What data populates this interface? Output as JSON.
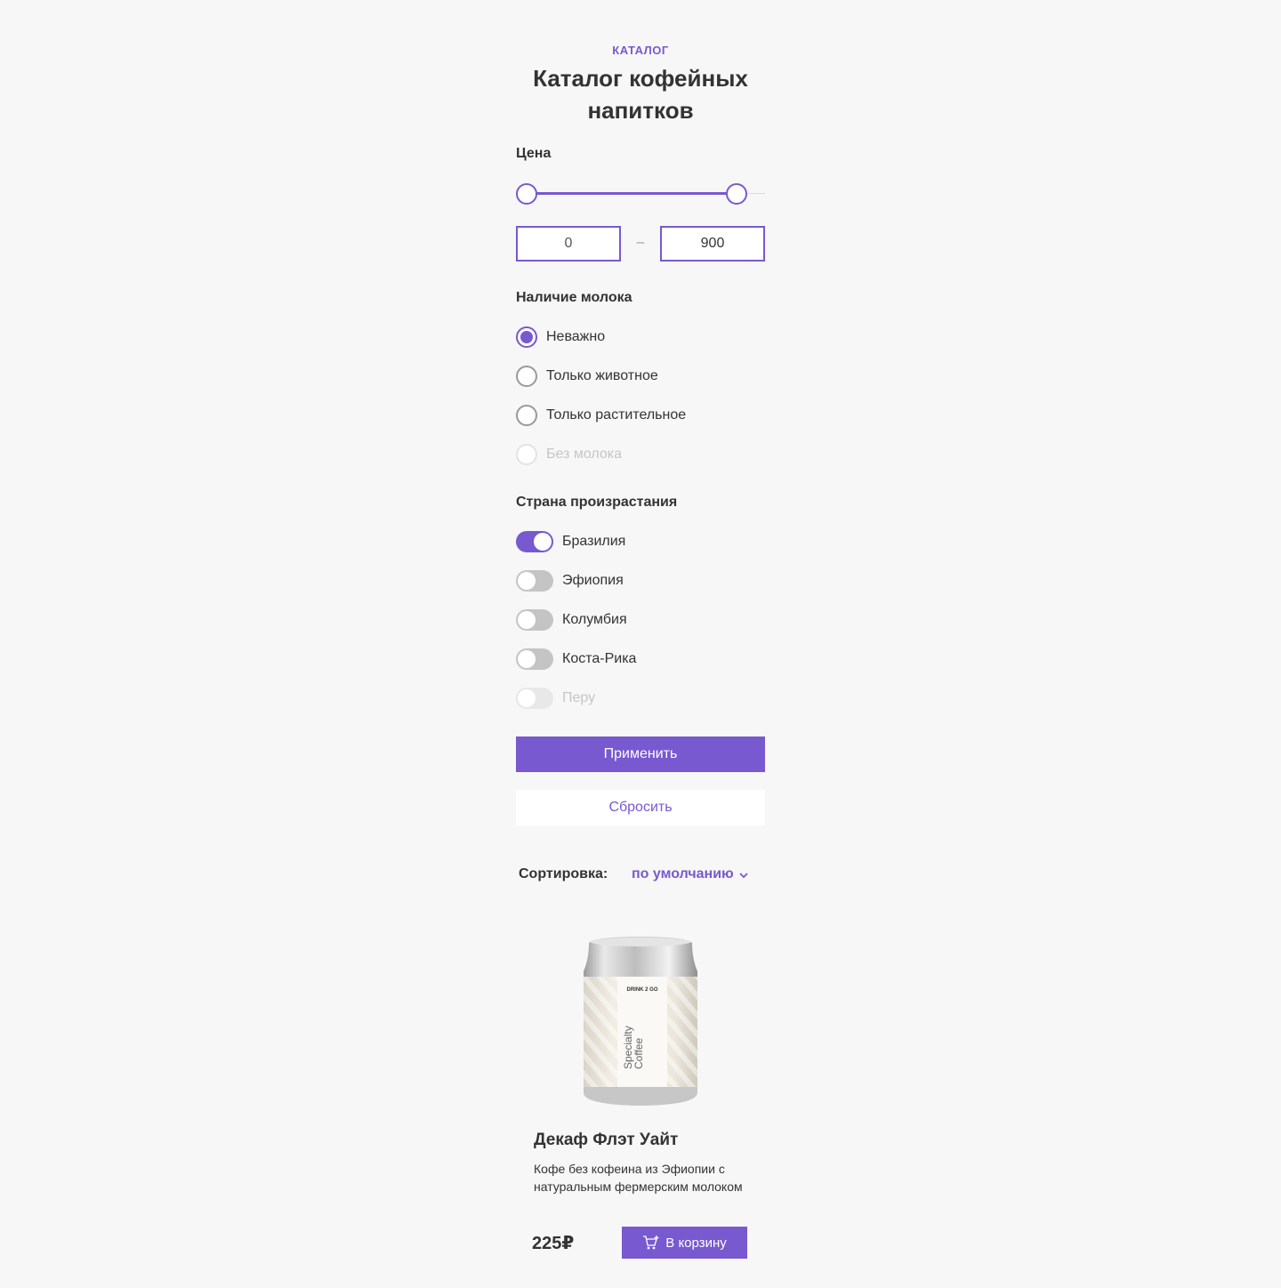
{
  "header": {
    "eyebrow": "КАТАЛОГ",
    "title": "Каталог кофейных напитков"
  },
  "price": {
    "label": "Цена",
    "min_value": "0",
    "max_value": "900",
    "separator": "–",
    "slider_min_fraction": 0,
    "slider_max_fraction": 1
  },
  "milk": {
    "label": "Наличие молока",
    "options": [
      {
        "label": "Неважно",
        "checked": true,
        "disabled": false
      },
      {
        "label": "Только животное",
        "checked": false,
        "disabled": false
      },
      {
        "label": "Только растительное",
        "checked": false,
        "disabled": false
      },
      {
        "label": "Без молока",
        "checked": false,
        "disabled": true
      }
    ]
  },
  "country": {
    "label": "Страна произрастания",
    "options": [
      {
        "label": "Бразилия",
        "on": true,
        "disabled": false
      },
      {
        "label": "Эфиопия",
        "on": false,
        "disabled": false
      },
      {
        "label": "Колумбия",
        "on": false,
        "disabled": false
      },
      {
        "label": "Коста-Рика",
        "on": false,
        "disabled": false
      },
      {
        "label": "Перу",
        "on": false,
        "disabled": true
      }
    ]
  },
  "actions": {
    "apply": "Применить",
    "reset": "Сбросить"
  },
  "sort": {
    "label": "Сортировка:",
    "value": "по умолчанию"
  },
  "product": {
    "can_brand": "DRINK 2 GO",
    "can_text_1": "Specialty",
    "can_text_2": "Coffee",
    "name": "Декаф Флэт Уайт",
    "description": "Кофе без кофеина из Эфиопии с натуральным фермерским молоком",
    "price": "225₽",
    "cart_label": "В корзину"
  },
  "colors": {
    "accent": "#7859cf",
    "background": "#f7f7f7",
    "text": "#333333"
  }
}
